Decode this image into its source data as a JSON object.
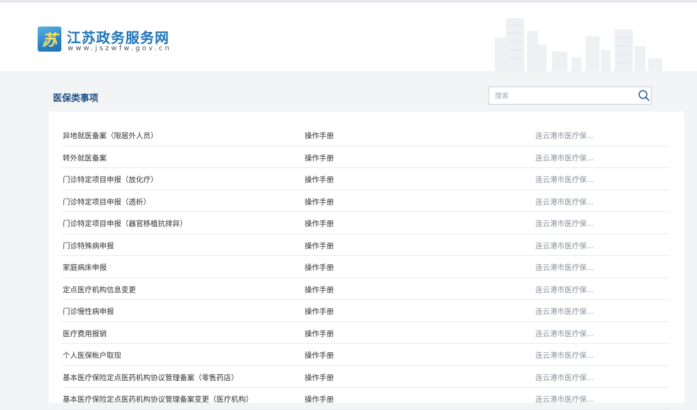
{
  "header": {
    "site_name": "江苏政务服务网",
    "site_url": "www.jszwfw.gov.cn",
    "logo_char": "苏"
  },
  "section": {
    "title": "医保类事项"
  },
  "search": {
    "placeholder": "搜索",
    "value": ""
  },
  "items": [
    {
      "name": "异地就医备案（限居外人员）",
      "manual": "操作手册",
      "dept": "连云港市医疗保..."
    },
    {
      "name": "转外就医备案",
      "manual": "操作手册",
      "dept": "连云港市医疗保..."
    },
    {
      "name": "门诊特定项目申报（放化疗）",
      "manual": "操作手册",
      "dept": "连云港市医疗保..."
    },
    {
      "name": "门诊特定项目申报（透析）",
      "manual": "操作手册",
      "dept": "连云港市医疗保..."
    },
    {
      "name": "门诊特定项目申报（器官移植抗排异）",
      "manual": "操作手册",
      "dept": "连云港市医疗保..."
    },
    {
      "name": "门诊特殊病申报",
      "manual": "操作手册",
      "dept": "连云港市医疗保..."
    },
    {
      "name": "家庭病床申报",
      "manual": "操作手册",
      "dept": "连云港市医疗保..."
    },
    {
      "name": "定点医疗机构信息变更",
      "manual": "操作手册",
      "dept": "连云港市医疗保..."
    },
    {
      "name": "门诊慢性病申报",
      "manual": "操作手册",
      "dept": "连云港市医疗保..."
    },
    {
      "name": "医疗费用报销",
      "manual": "操作手册",
      "dept": "连云港市医疗保..."
    },
    {
      "name": "个人医保帐户取现",
      "manual": "操作手册",
      "dept": "连云港市医疗保..."
    },
    {
      "name": "基本医疗保险定点医药机构协议管理备案（零售药店）",
      "manual": "操作手册",
      "dept": "连云港市医疗保..."
    },
    {
      "name": "基本医疗保险定点医药机构协议管理备案变更（医疗机构）",
      "manual": "操作手册",
      "dept": "连云港市医疗保..."
    }
  ],
  "colors": {
    "brand": "#1f73b7",
    "title": "#1f4f86",
    "muted": "#8a9099"
  }
}
